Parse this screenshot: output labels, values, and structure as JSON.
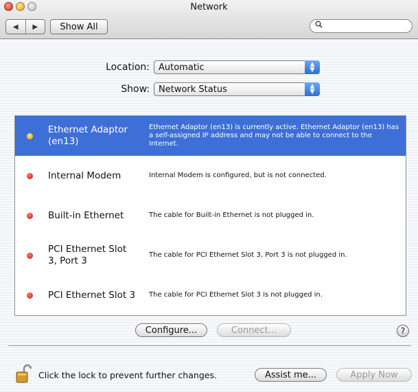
{
  "window": {
    "title": "Network"
  },
  "toolbar": {
    "back_glyph": "◀",
    "forward_glyph": "▶",
    "show_all_label": "Show All",
    "search_value": ""
  },
  "location": {
    "label": "Location:",
    "value": "Automatic"
  },
  "show": {
    "label": "Show:",
    "value": "Network Status"
  },
  "services": [
    {
      "name": "Ethernet Adaptor (en13)",
      "status": "yellow",
      "selected": true,
      "description": "Ethernet Adaptor (en13) is currently active. Ethernet Adaptor (en13) has a self-assigned IP address and may not be able to connect to the Internet."
    },
    {
      "name": "Internal Modem",
      "status": "red",
      "selected": false,
      "description": "Internal Modem is configured, but is not connected."
    },
    {
      "name": "Built-in Ethernet",
      "status": "red",
      "selected": false,
      "description": "The cable for Built-in Ethernet is not plugged in."
    },
    {
      "name": "PCI Ethernet Slot 3, Port 3",
      "status": "red",
      "selected": false,
      "description": "The cable for PCI Ethernet Slot 3, Port 3 is not plugged in."
    },
    {
      "name": "PCI Ethernet Slot 3",
      "status": "red",
      "selected": false,
      "description": "The cable for PCI Ethernet Slot 3 is not plugged in."
    }
  ],
  "buttons": {
    "configure": "Configure...",
    "connect": "Connect...",
    "help": "?",
    "assist": "Assist me...",
    "apply": "Apply Now"
  },
  "lock_text": "Click the lock to prevent further changes.",
  "colors": {
    "selection": "#3e6fd6",
    "status_red": "#c0160b",
    "status_yellow": "#e3a100"
  }
}
